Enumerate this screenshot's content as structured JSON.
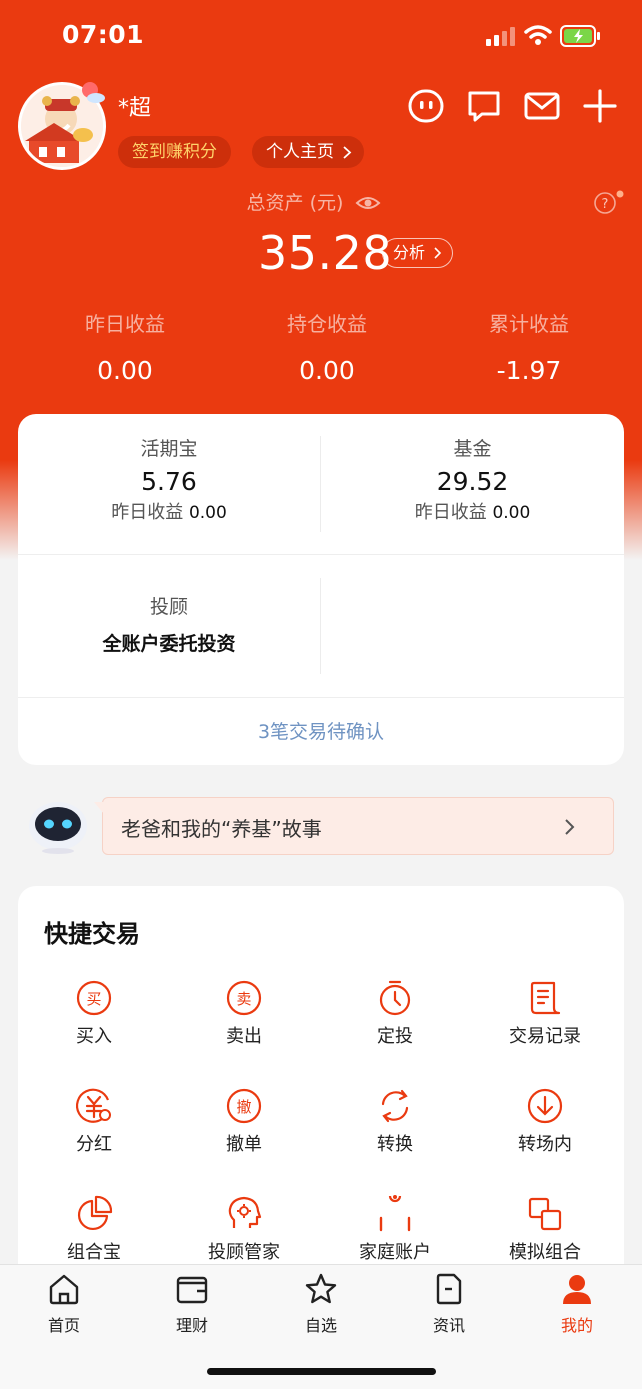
{
  "status": {
    "time": "07:01"
  },
  "user": {
    "name": "*超",
    "checkin_label": "签到赚积分",
    "profile_label": "个人主页"
  },
  "assets": {
    "total_label": "总资产 (元)",
    "total_value": "35.28",
    "analysis_label": "分析",
    "stats": [
      {
        "label": "昨日收益",
        "value": "0.00"
      },
      {
        "label": "持仓收益",
        "value": "0.00"
      },
      {
        "label": "累计收益",
        "value": "-1.97"
      }
    ]
  },
  "accounts": {
    "huoqibao": {
      "label": "活期宝",
      "value": "5.76",
      "sub_label": "昨日收益",
      "sub_value": "0.00"
    },
    "fund": {
      "label": "基金",
      "value": "29.52",
      "sub_label": "昨日收益",
      "sub_value": "0.00"
    },
    "advisor": {
      "label": "投顾",
      "value": "全账户委托投资"
    },
    "pending": "3笔交易待确认"
  },
  "banner": {
    "text": "老爸和我的“养基”故事"
  },
  "quick_trade": {
    "title": "快捷交易",
    "items": [
      {
        "label": "买入",
        "icon": "buy-icon"
      },
      {
        "label": "卖出",
        "icon": "sell-icon"
      },
      {
        "label": "定投",
        "icon": "timer-icon"
      },
      {
        "label": "交易记录",
        "icon": "record-icon"
      },
      {
        "label": "分红",
        "icon": "dividend-icon"
      },
      {
        "label": "撤单",
        "icon": "cancel-order-icon"
      },
      {
        "label": "转换",
        "icon": "convert-icon"
      },
      {
        "label": "转场内",
        "icon": "transfer-icon"
      },
      {
        "label": "组合宝",
        "icon": "pie-icon"
      },
      {
        "label": "投顾管家",
        "icon": "advisor-icon"
      },
      {
        "label": "家庭账户",
        "icon": "family-icon"
      },
      {
        "label": "模拟组合",
        "icon": "simulate-icon"
      }
    ],
    "icon_glyphs": [
      "买",
      "卖",
      "",
      "",
      "",
      "撤"
    ]
  },
  "tabs": [
    {
      "label": "首页",
      "icon": "home-icon"
    },
    {
      "label": "理财",
      "icon": "wallet-icon"
    },
    {
      "label": "自选",
      "icon": "star-icon"
    },
    {
      "label": "资讯",
      "icon": "news-icon"
    },
    {
      "label": "我的",
      "icon": "user-icon",
      "active": true
    }
  ],
  "colors": {
    "brand": "#EA3A10",
    "link": "#6f93c2",
    "banner_bg": "#FDECE6"
  }
}
